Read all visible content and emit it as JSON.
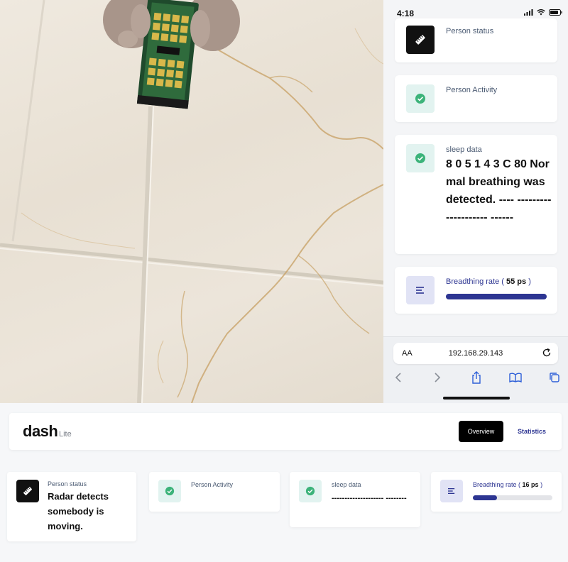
{
  "phone": {
    "status_time": "4:18",
    "cards": {
      "person_status": {
        "label": "Person status",
        "icon": "ruler-icon"
      },
      "person_activity": {
        "label": "Person Activity",
        "icon": "check-circle-icon"
      },
      "sleep_data": {
        "label": "sleep data",
        "value": "8 0 5 1 4 3 C 80 Normal breathing was detected. ---- -------------------- ------",
        "icon": "check-circle-icon"
      },
      "breathing": {
        "label_prefix": "Breadthing rate ( ",
        "value": "55 ps",
        "label_suffix": " )",
        "progress": 1.0,
        "icon": "list-icon"
      }
    },
    "browser": {
      "aa": "AA",
      "url": "192.168.29.143"
    }
  },
  "dashboard": {
    "brand": "dash",
    "brand_sub": "Lite",
    "nav": {
      "overview": "Overview",
      "statistics": "Statistics"
    },
    "cards": {
      "person_status": {
        "label": "Person status",
        "value": "Radar detects somebody is moving.",
        "icon": "ruler-icon"
      },
      "person_activity": {
        "label": "Person Activity",
        "icon": "check-circle-icon"
      },
      "sleep_data": {
        "label": "sleep data",
        "value": "-------------------- --------",
        "icon": "check-circle-icon"
      },
      "breathing": {
        "label_prefix": "Breadthing rate ( ",
        "value": "16 ps",
        "label_suffix": " )",
        "progress": 0.3,
        "icon": "list-icon"
      }
    }
  },
  "colors": {
    "accent": "#2d3592",
    "teal_bg": "#e2f3f0",
    "check": "#3cb37a",
    "lavender_bg": "#e1e3f5"
  }
}
